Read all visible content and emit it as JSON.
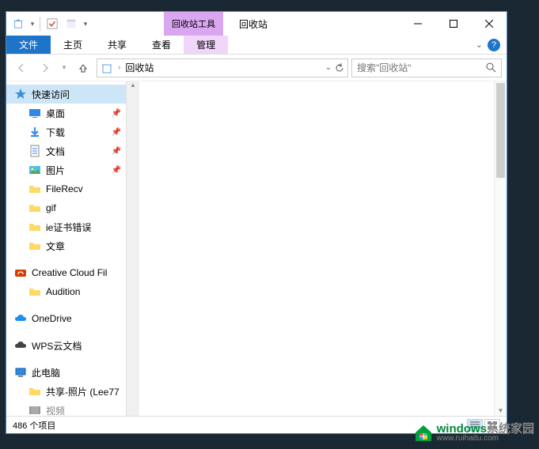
{
  "titlebar": {
    "contextual_tab_label": "回收站工具",
    "window_title": "回收站"
  },
  "ribbon": {
    "file": "文件",
    "home": "主页",
    "share": "共享",
    "view": "查看",
    "manage": "管理"
  },
  "address": {
    "location": "回收站"
  },
  "search": {
    "placeholder": "搜索\"回收站\""
  },
  "sidebar": {
    "quick_access": "快速访问",
    "items_pinned": [
      {
        "label": "桌面"
      },
      {
        "label": "下载"
      },
      {
        "label": "文档"
      },
      {
        "label": "图片"
      }
    ],
    "items_unpinned": [
      {
        "label": "FileRecv"
      },
      {
        "label": "gif"
      },
      {
        "label": "ie证书错误"
      },
      {
        "label": "文章"
      }
    ],
    "creative_cloud": "Creative Cloud Fil",
    "audition": "Audition",
    "onedrive": "OneDrive",
    "wps": "WPS云文档",
    "this_pc": "此电脑",
    "shared_photos": "共享-照片 (Lee77",
    "videos": "视频"
  },
  "status": {
    "text": "486 个项目"
  },
  "watermark": {
    "line1a": "windows",
    "line1b": "系统家园",
    "line2": "www.ruihaitu.com"
  }
}
